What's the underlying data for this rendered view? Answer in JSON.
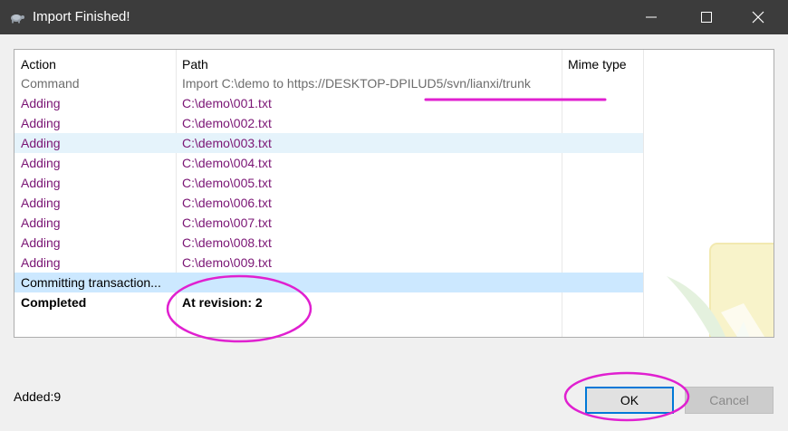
{
  "window": {
    "title": "Import Finished!",
    "icon": "tortoise-icon",
    "controls": [
      "minimize-icon",
      "maximize-icon",
      "close-icon"
    ]
  },
  "table": {
    "columns": [
      "Action",
      "Path",
      "Mime type"
    ],
    "rows": [
      {
        "action": "Command",
        "path": "Import C:\\demo to https://DESKTOP-DPILUD5/svn/lianxi/trunk"
      },
      {
        "action": "Adding",
        "path": "C:\\demo\\001.txt"
      },
      {
        "action": "Adding",
        "path": "C:\\demo\\002.txt"
      },
      {
        "action": "Adding",
        "path": "C:\\demo\\003.txt"
      },
      {
        "action": "Adding",
        "path": "C:\\demo\\004.txt"
      },
      {
        "action": "Adding",
        "path": "C:\\demo\\005.txt"
      },
      {
        "action": "Adding",
        "path": "C:\\demo\\006.txt"
      },
      {
        "action": "Adding",
        "path": "C:\\demo\\007.txt"
      },
      {
        "action": "Adding",
        "path": "C:\\demo\\008.txt"
      },
      {
        "action": "Adding",
        "path": "C:\\demo\\009.txt"
      },
      {
        "action": "Committing transaction...",
        "path": ""
      },
      {
        "action": "Completed",
        "path": "At revision: 2"
      }
    ]
  },
  "footer": {
    "summary": "Added:9",
    "ok_label": "OK",
    "cancel_label": "Cancel"
  },
  "colors": {
    "titlebar": "#3c3c3c",
    "command_text": "#6d6d6d",
    "adding_text": "#7a1474",
    "selected_row": "#cce8ff",
    "hover_row": "#e5f3fb",
    "annotation": "#e020d0",
    "focus_border": "#0078d7"
  }
}
